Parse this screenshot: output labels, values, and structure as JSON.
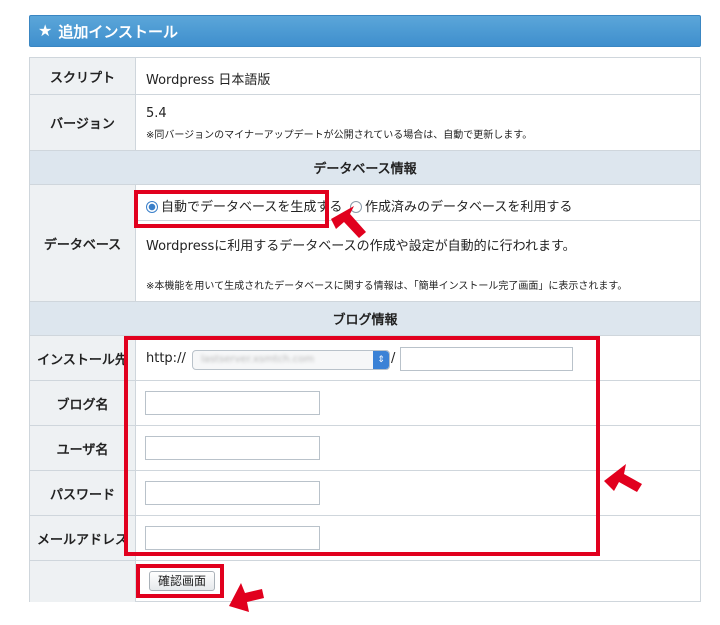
{
  "header": {
    "title": "追加インストール",
    "star_icon": "star-icon"
  },
  "rows": {
    "script": {
      "label": "スクリプト",
      "value": "Wordpress 日本語版"
    },
    "version": {
      "label": "バージョン",
      "value": "5.4",
      "note": "※同バージョンのマイナーアップデートが公開されている場合は、自動で更新します。"
    }
  },
  "db_section": {
    "title": "データベース情報"
  },
  "database": {
    "label": "データベース",
    "option_auto": "自動でデータベースを生成する",
    "option_existing": "作成済みのデータベースを利用する",
    "selected": "option_auto",
    "description": "Wordpressに利用するデータベースの作成や設定が自動的に行われます。",
    "note": "※本機能を用いて生成されたデータベースに関する情報は、「簡単インストール完了画面」に表示されます。"
  },
  "blog_section": {
    "title": "ブログ情報"
  },
  "install_dest": {
    "label": "インストール先",
    "prefix": "http://",
    "domain": "lastserver.xsmtch.com",
    "separator": "/",
    "path": ""
  },
  "blog_name": {
    "label": "ブログ名",
    "value": ""
  },
  "user_name": {
    "label": "ユーザ名",
    "value": ""
  },
  "password": {
    "label": "パスワード",
    "value": ""
  },
  "email": {
    "label": "メールアドレス",
    "value": ""
  },
  "confirm_button": {
    "label": "確認画面"
  },
  "colors": {
    "header": "#3f8fcd",
    "highlight": "#e1001e",
    "label_bg": "#eef1f3",
    "section_bg": "#dde6ee"
  }
}
